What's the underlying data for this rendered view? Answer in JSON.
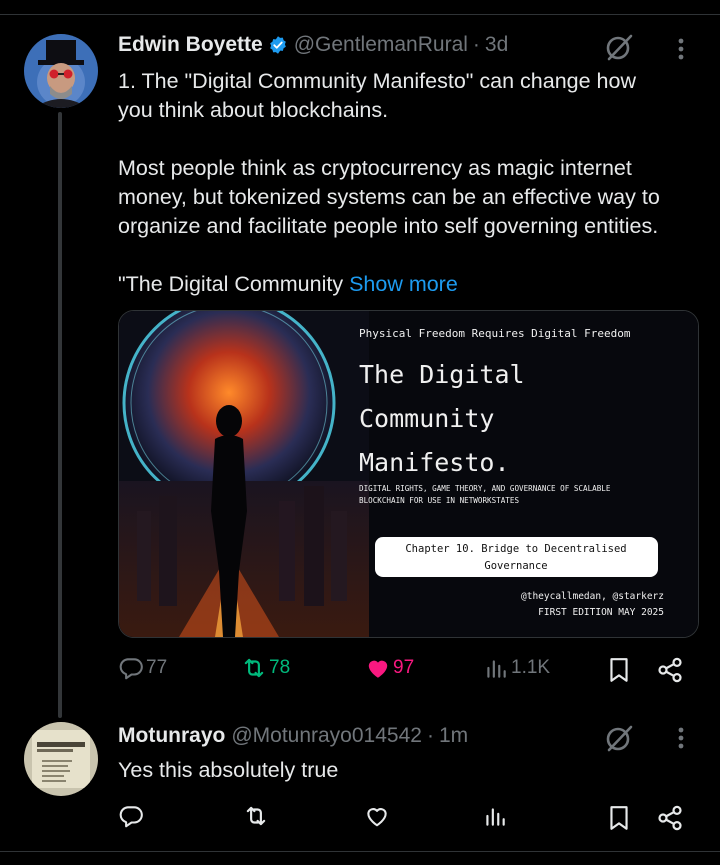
{
  "tweets": [
    {
      "name": "Edwin Boyette",
      "handle": "@GentlemanRural",
      "dot": "·",
      "time": "3d",
      "verified": true,
      "lines": [
        "1. The \"Digital Community Manifesto\" can change how",
        "you think about blockchains.",
        "",
        "Most people think as cryptocurrency as magic internet",
        "money, but tokenized systems can be an effective way to",
        "organize and facilitate people into self governing entities.",
        "",
        "\"The Digital Community "
      ],
      "show_more": "Show more",
      "media": {
        "tagline": "Physical Freedom Requires Digital Freedom",
        "title_1": "The Digital",
        "title_2": "Community",
        "title_3": "Manifesto.",
        "subtitle_1": "DIGITAL RIGHTS, GAME THEORY, AND GOVERNANCE OF SCALABLE",
        "subtitle_2": "BLOCKCHAIN FOR USE IN NETWORKSTATES",
        "chapter_1": "Chapter 10. Bridge to Decentralised",
        "chapter_2": "Governance",
        "authors": "@theycallmedan, @starkerz",
        "edition": "FIRST EDITION MAY 2025"
      },
      "actions": {
        "replies": "77",
        "reposts": "78",
        "likes": "97",
        "views": "1.1K"
      }
    },
    {
      "name": "Motunrayo",
      "handle": "@Motunrayo014542",
      "dot": "·",
      "time": "1m",
      "text": "Yes this absolutely true"
    }
  ],
  "icons": {
    "reply": "speech-bubble-icon",
    "repost": "repost-arrows-icon",
    "like": "heart-icon",
    "views": "bar-chart-icon",
    "bookmark": "bookmark-icon",
    "share": "share-icon",
    "grok": "grok-icon",
    "more": "more-dots-icon"
  },
  "colors": {
    "background": "#000000",
    "text": "#e7e9ea",
    "muted": "#71767b",
    "link": "#1d9bf0",
    "repost_active": "#00ba7c",
    "like_active": "#f91880",
    "verified": "#1d9bf0"
  }
}
